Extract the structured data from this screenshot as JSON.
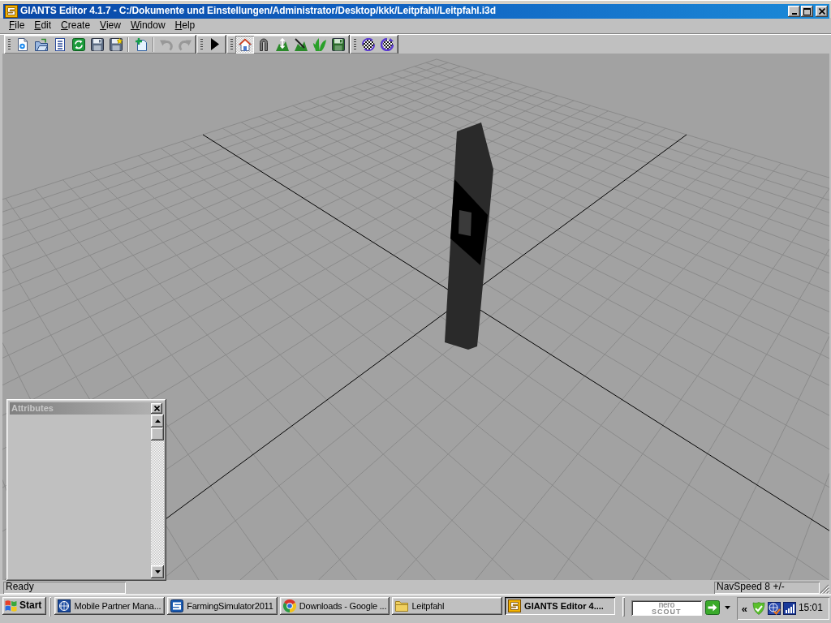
{
  "window": {
    "title": "GIANTS Editor 4.1.7 - C:/Dokumente und Einstellungen/Administrator/Desktop/kkk/Leitpfahl/Leitpfahl.i3d"
  },
  "menu": [
    "File",
    "Edit",
    "Create",
    "View",
    "Window",
    "Help"
  ],
  "toolbars": [
    {
      "items": [
        {
          "kind": "new",
          "disabled": false,
          "pressed": false
        },
        {
          "kind": "open",
          "disabled": false,
          "pressed": false
        },
        {
          "kind": "list",
          "disabled": false,
          "pressed": false
        },
        {
          "kind": "refresh",
          "disabled": false,
          "pressed": false
        },
        {
          "kind": "save",
          "disabled": false,
          "pressed": false
        },
        {
          "kind": "saveas",
          "disabled": false,
          "pressed": false
        },
        {
          "kind": "separator"
        },
        {
          "kind": "add",
          "disabled": false,
          "pressed": false
        },
        {
          "kind": "separator"
        },
        {
          "kind": "undo",
          "disabled": true,
          "pressed": false
        },
        {
          "kind": "redo",
          "disabled": true,
          "pressed": false
        }
      ]
    },
    {
      "items": [
        {
          "kind": "play",
          "disabled": false,
          "pressed": false
        }
      ]
    },
    {
      "items": [
        {
          "kind": "home",
          "disabled": false,
          "pressed": true
        },
        {
          "kind": "magnet",
          "disabled": false,
          "pressed": false
        },
        {
          "kind": "sculpt",
          "disabled": false,
          "pressed": false
        },
        {
          "kind": "paint",
          "disabled": false,
          "pressed": false
        },
        {
          "kind": "foliage",
          "disabled": false,
          "pressed": false
        },
        {
          "kind": "export",
          "disabled": false,
          "pressed": false
        }
      ]
    },
    {
      "items": [
        {
          "kind": "checker",
          "disabled": false,
          "pressed": false
        },
        {
          "kind": "checkeralt",
          "disabled": false,
          "pressed": false
        }
      ]
    }
  ],
  "attributes_panel": {
    "title": "Attributes"
  },
  "status_bar": {
    "message": "Ready",
    "nav_speed": "NavSpeed 8 +/-"
  },
  "taskbar": {
    "start": "Start",
    "tasks": [
      {
        "label": "Mobile Partner Mana...",
        "kind": "globe",
        "selected": false
      },
      {
        "label": "FarmingSimulator2011",
        "kind": "farming",
        "selected": false
      },
      {
        "label": "Downloads - Google ...",
        "kind": "browser",
        "selected": false
      },
      {
        "label": "Leitpfahl",
        "kind": "folder",
        "selected": false
      },
      {
        "label": "GIANTS Editor 4....",
        "kind": "giants",
        "selected": true
      }
    ],
    "scout": {
      "line_1": "nero",
      "line_2": "SCOUT"
    },
    "tray": {
      "chevron": "«",
      "clock": "15:01"
    }
  }
}
